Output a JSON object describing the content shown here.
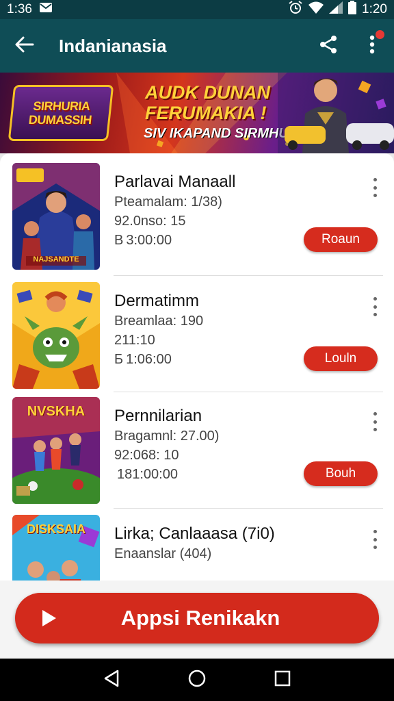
{
  "status_bar": {
    "time_left": "1:36",
    "time_right": "1:20",
    "icons": [
      "mail-icon",
      "alarm-icon",
      "wifi-icon",
      "signal-icon",
      "battery-icon"
    ]
  },
  "app_bar": {
    "title": "Indanianasia",
    "icons": [
      "back-arrow-icon",
      "share-icon",
      "more-vert-icon"
    ]
  },
  "banner": {
    "logo_line1": "SIRHURIA",
    "logo_line2": "DUMASSIH",
    "headline_line1": "AUDK DUNAN",
    "headline_line2": "FERUMAKIA !",
    "subline": "SIV IKAPAND SIRMHU"
  },
  "items": [
    {
      "thumb_label": "",
      "thumb_bottom": "NAJSANDTE",
      "title": "Parlavai Manaall",
      "meta": "Pteamalam: 1/38)",
      "meta2": "92.0nso: 15",
      "time": "3:00:00",
      "time_prefix": "В",
      "button": "Roaun"
    },
    {
      "thumb_label": "",
      "thumb_bottom": "",
      "title": "Dermatimm",
      "meta": "Breamlaa: 190",
      "meta2": "211:10",
      "time": "1:06:00",
      "time_prefix": "Б",
      "button": "Louln"
    },
    {
      "thumb_label": "NVSKHA",
      "thumb_bottom": "",
      "title": "Pernnilarian",
      "meta": "Bragamnl: 27.00)",
      "meta2": "92:068: 10",
      "time": "181:00:00",
      "time_prefix": "",
      "button": "Bouh"
    },
    {
      "thumb_label": "DISKSAIA",
      "thumb_bottom": "",
      "title": "Lirka; Canlaaasa (7i0)",
      "meta": "Enaanslar (404)",
      "meta2": "",
      "time": "",
      "time_prefix": "",
      "button": ""
    }
  ],
  "cta": {
    "label": "Appsi Renikakn",
    "icon": "play-icon"
  },
  "nav_bar": {
    "icons": [
      "nav-back-icon",
      "nav-home-icon",
      "nav-recents-icon"
    ]
  },
  "colors": {
    "app_bar": "#0f4d56",
    "status_bar": "#0c3c44",
    "accent_red": "#d62c1e"
  }
}
